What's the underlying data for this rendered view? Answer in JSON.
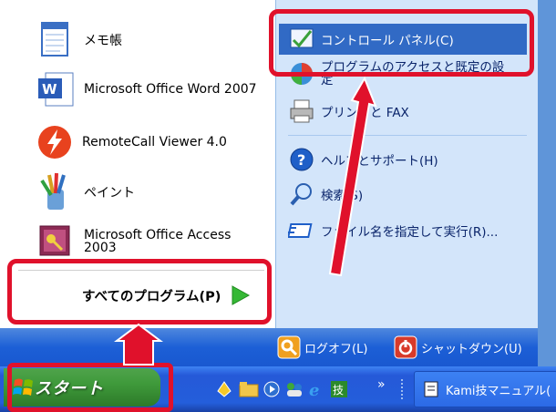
{
  "start_menu": {
    "pinned": [
      {
        "label": "メモ帳",
        "icon": "notepad-icon"
      },
      {
        "label": "Microsoft Office Word 2007",
        "icon": "word-icon"
      },
      {
        "label": "RemoteCall Viewer 4.0",
        "icon": "remotecall-icon"
      },
      {
        "label": "ペイント",
        "icon": "paint-icon"
      },
      {
        "label": "Microsoft Office Access 2003",
        "icon": "access-icon"
      }
    ],
    "all_programs_label": "すべてのプログラム(P)",
    "right_items": [
      {
        "label": "コントロール パネル(C)",
        "icon": "control-panel-icon"
      },
      {
        "label": "プログラムのアクセスと既定の設定",
        "icon": "program-access-icon"
      },
      {
        "label": "プリンタと FAX",
        "icon": "printer-icon"
      },
      {
        "label": "ヘルプとサポート(H)",
        "icon": "help-icon"
      },
      {
        "label": "検索(S)",
        "icon": "search-icon"
      },
      {
        "label": "ファイル名を指定して実行(R)...",
        "icon": "run-icon"
      }
    ],
    "logoff_label": "ログオフ(L)",
    "shutdown_label": "シャットダウン(U)"
  },
  "taskbar": {
    "start_label": "スタート",
    "quick_launch_icons": [
      "desktop-icon",
      "folder-icon",
      "media-icon",
      "messenger-icon",
      "ie-icon",
      "kanji-icon"
    ],
    "overflow": "»",
    "task_button_label": "Kami技マニュアル("
  },
  "colors": {
    "highlight": "#316ac5",
    "annotation_red": "#e0112b",
    "taskbar_blue": "#245edb",
    "start_green": "#3f9a3b"
  }
}
